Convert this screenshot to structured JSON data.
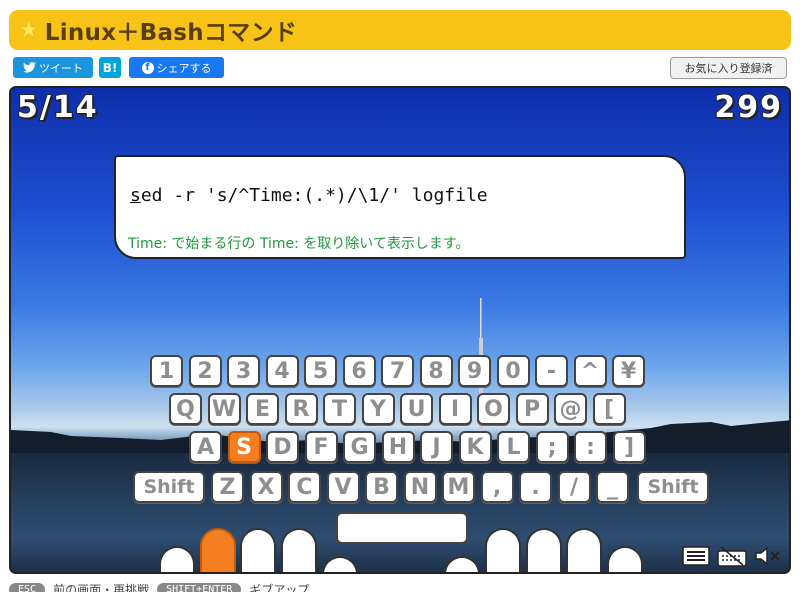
{
  "header": {
    "title": "Linux＋Bashコマンド"
  },
  "share": {
    "tweet_label": "ツイート",
    "hatena_label": "B!",
    "facebook_label": "シェアする",
    "favorite_label": "お気に入り登録済"
  },
  "game": {
    "progress": "5/14",
    "score": "299",
    "command_next_char": "s",
    "command_rest": "ed -r 's/^Time:(.*)/\\1/' logfile",
    "description": "Time: で始まる行の Time: を取り除いて表示します。",
    "active_key": "S",
    "active_finger": "left-ring"
  },
  "keyboard": {
    "row1": [
      "1",
      "2",
      "3",
      "4",
      "5",
      "6",
      "7",
      "8",
      "9",
      "0",
      "-",
      "^",
      "¥"
    ],
    "row2": [
      "Q",
      "W",
      "E",
      "R",
      "T",
      "Y",
      "U",
      "I",
      "O",
      "P",
      "@",
      "["
    ],
    "row3": [
      "A",
      "S",
      "D",
      "F",
      "G",
      "H",
      "J",
      "K",
      "L",
      ";",
      ":",
      "]"
    ],
    "row4_left": "Shift",
    "row4": [
      "Z",
      "X",
      "C",
      "V",
      "B",
      "N",
      "M",
      ",",
      ".",
      "/",
      "_"
    ],
    "row4_right": "Shift"
  },
  "hints": {
    "esc_key": "ESC",
    "esc_label": "前の画面・再挑戦",
    "giveup_key": "SHIFT+ENTER",
    "giveup_label": "ギブアップ"
  },
  "colors": {
    "title_bar": "#f7c317",
    "accent": "#f57f20",
    "description_text": "#1e9a3a"
  }
}
